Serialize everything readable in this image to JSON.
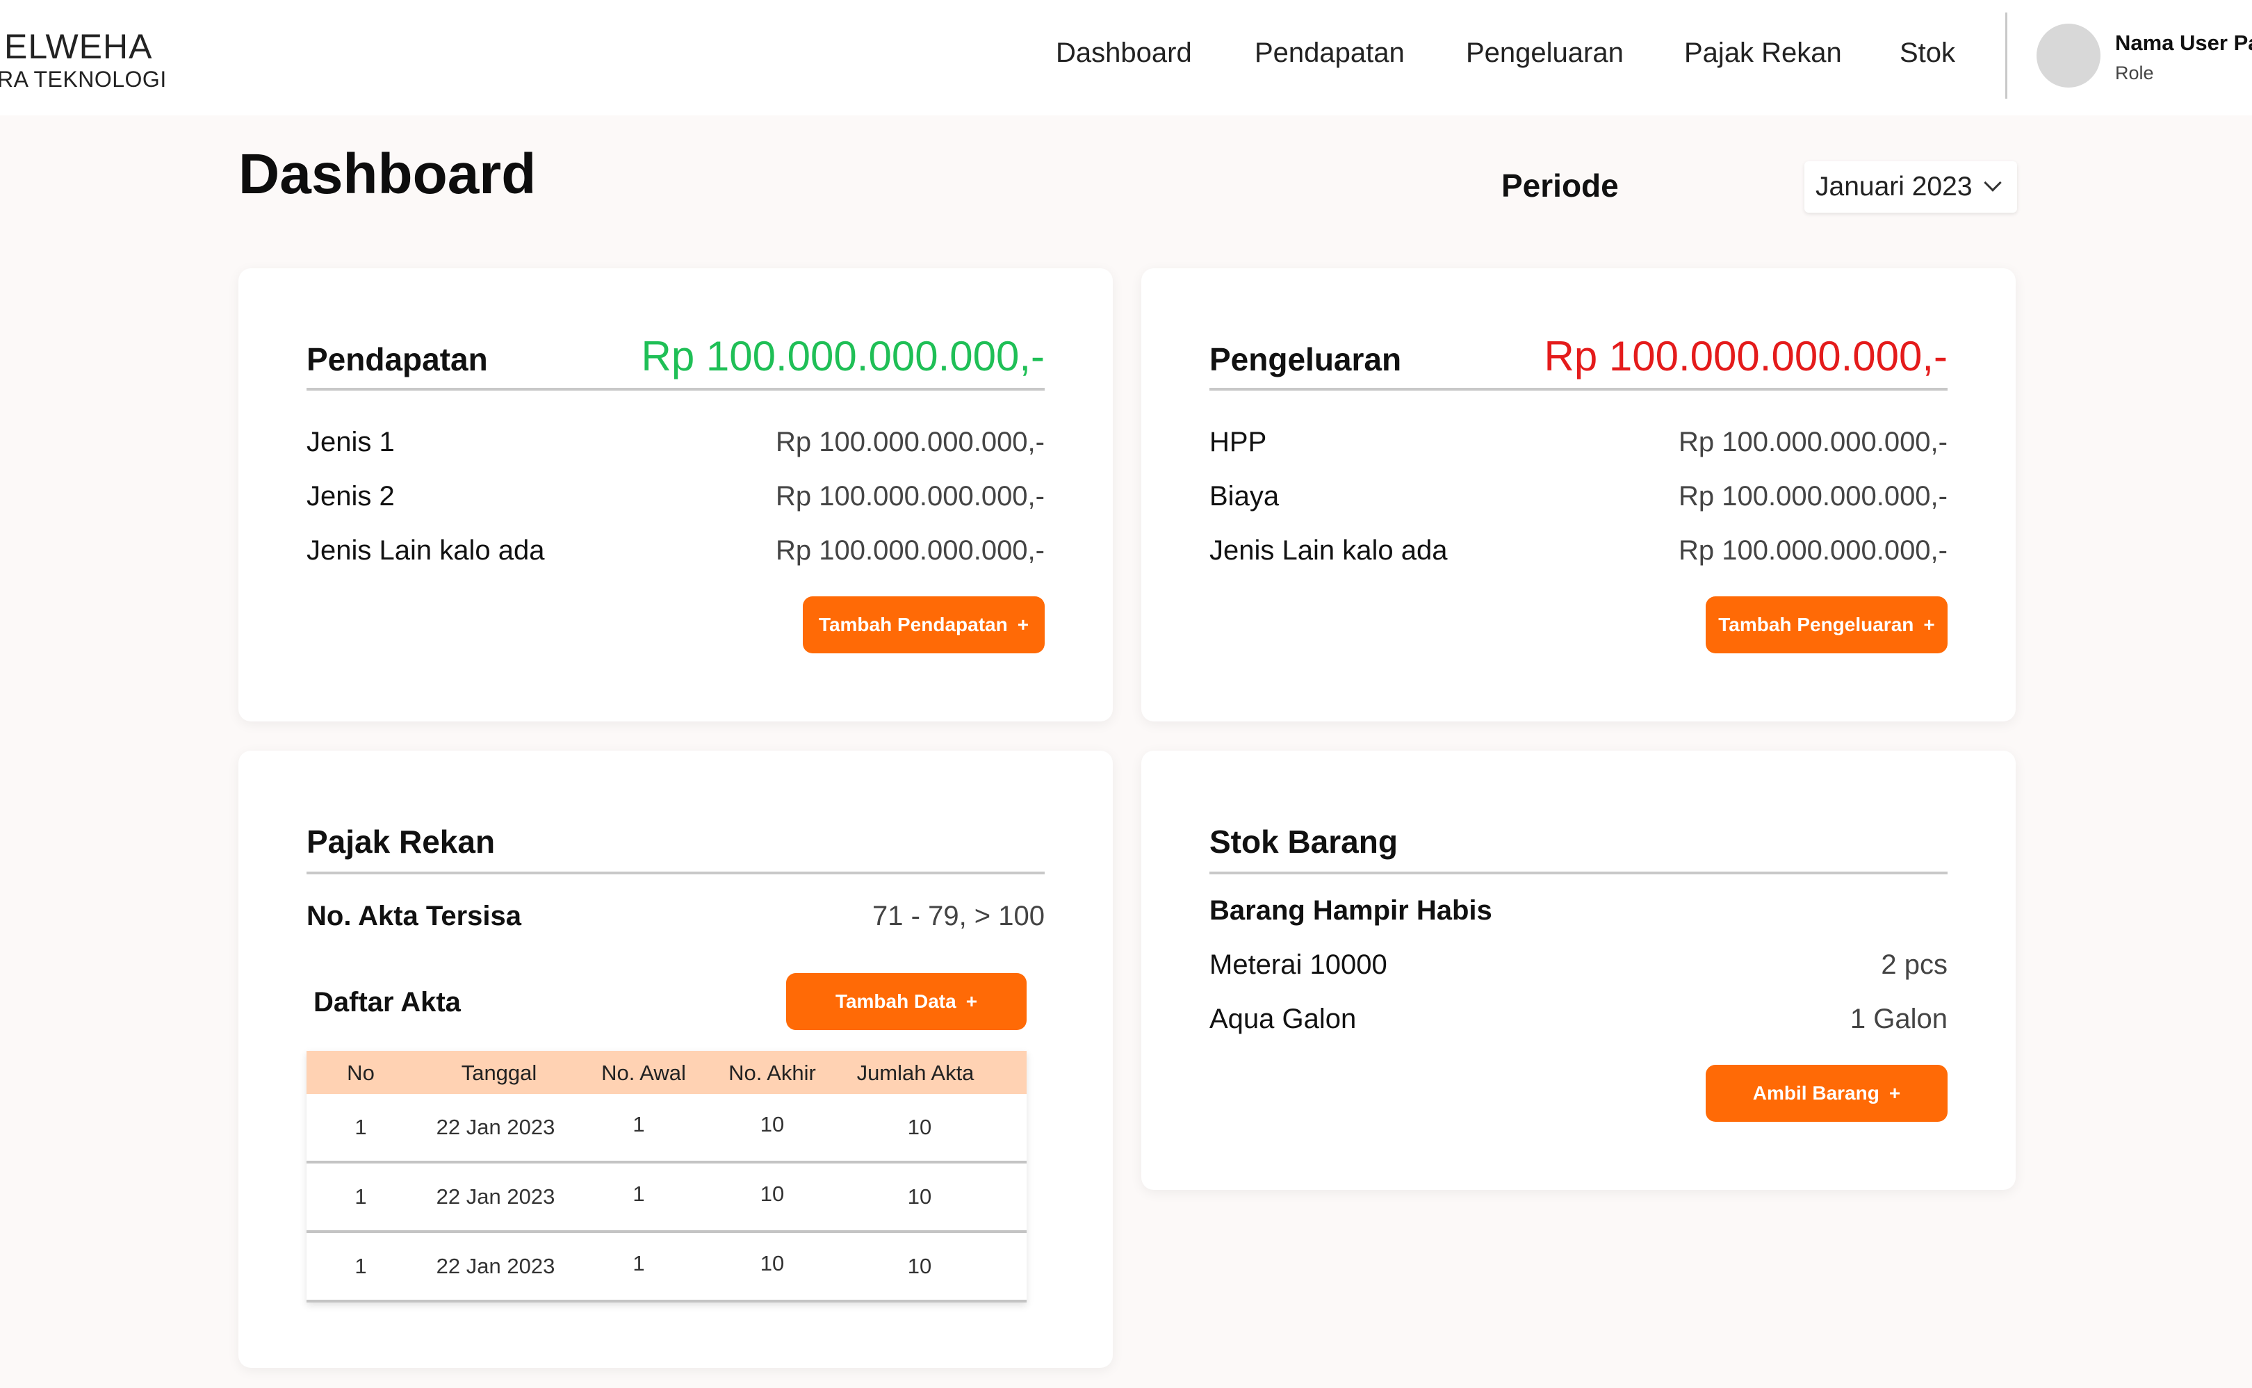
{
  "brand": {
    "name": "ELWEHA",
    "tagline": "RA TEKNOLOGI"
  },
  "nav": {
    "items": [
      "Dashboard",
      "Pendapatan",
      "Pengeluaran",
      "Pajak Rekan",
      "Stok"
    ]
  },
  "user": {
    "name": "Nama User Pa",
    "role": "Role"
  },
  "page": {
    "title": "Dashboard",
    "periode_label": "Periode",
    "periode_value": "Januari 2023"
  },
  "pendapatan": {
    "title": "Pendapatan",
    "total": "Rp 100.000.000.000,-",
    "rows": [
      {
        "label": "Jenis 1",
        "value": "Rp 100.000.000.000,-"
      },
      {
        "label": "Jenis 2",
        "value": "Rp 100.000.000.000,-"
      },
      {
        "label": "Jenis Lain kalo ada",
        "value": "Rp 100.000.000.000,-"
      }
    ],
    "button": "Tambah Pendapatan",
    "total_color": "#1fbf56"
  },
  "pengeluaran": {
    "title": "Pengeluaran",
    "total": "Rp 100.000.000.000,-",
    "rows": [
      {
        "label": "HPP",
        "value": "Rp 100.000.000.000,-"
      },
      {
        "label": "Biaya",
        "value": "Rp 100.000.000.000,-"
      },
      {
        "label": "Jenis Lain kalo ada",
        "value": "Rp 100.000.000.000,-"
      }
    ],
    "button": "Tambah Pengeluaran",
    "total_color": "#e41b1b"
  },
  "pajak_rekan": {
    "title": "Pajak Rekan",
    "akta_tersisa_label": "No. Akta Tersisa",
    "akta_tersisa_value": "71 - 79, > 100",
    "daftar_title": "Daftar Akta",
    "button": "Tambah Data",
    "columns": [
      "No",
      "Tanggal",
      "No. Awal",
      "No. Akhir",
      "Jumlah Akta"
    ],
    "rows": [
      [
        "1",
        "22 Jan 2023",
        "1",
        "10",
        "10"
      ],
      [
        "1",
        "22 Jan 2023",
        "1",
        "10",
        "10"
      ],
      [
        "1",
        "22 Jan 2023",
        "1",
        "10",
        "10"
      ]
    ]
  },
  "stok": {
    "title": "Stok Barang",
    "subtitle": "Barang Hampir Habis",
    "rows": [
      {
        "label": "Meterai 10000",
        "value": "2 pcs"
      },
      {
        "label": "Aqua Galon",
        "value": "1 Galon"
      }
    ],
    "button": "Ambil Barang"
  },
  "colors": {
    "accent": "#ff6a06",
    "table_header": "#ffd2b3"
  }
}
